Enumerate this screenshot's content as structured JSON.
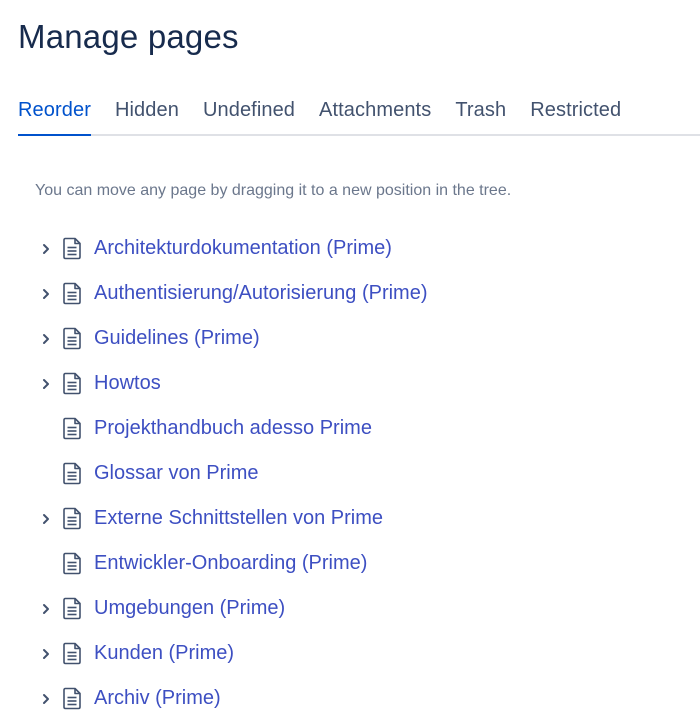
{
  "title": "Manage pages",
  "tabs": [
    {
      "label": "Reorder",
      "active": true
    },
    {
      "label": "Hidden",
      "active": false
    },
    {
      "label": "Undefined",
      "active": false
    },
    {
      "label": "Attachments",
      "active": false
    },
    {
      "label": "Trash",
      "active": false
    },
    {
      "label": "Restricted",
      "active": false
    }
  ],
  "help_text": "You can move any page by dragging it to a new position in the tree.",
  "tree": [
    {
      "label": "Architekturdokumentation (Prime)",
      "has_children": true
    },
    {
      "label": "Authentisierung/Autorisierung (Prime)",
      "has_children": true
    },
    {
      "label": "Guidelines (Prime)",
      "has_children": true
    },
    {
      "label": "Howtos",
      "has_children": true
    },
    {
      "label": "Projekthandbuch adesso Prime",
      "has_children": false
    },
    {
      "label": "Glossar von Prime",
      "has_children": false
    },
    {
      "label": "Externe Schnittstellen von Prime",
      "has_children": true
    },
    {
      "label": "Entwickler-Onboarding (Prime)",
      "has_children": false
    },
    {
      "label": "Umgebungen (Prime)",
      "has_children": true
    },
    {
      "label": "Kunden (Prime)",
      "has_children": true
    },
    {
      "label": "Archiv (Prime)",
      "has_children": true
    }
  ],
  "icons": {
    "expand": "chevron-right-icon",
    "page": "page-icon"
  },
  "colors": {
    "title": "#172b4d",
    "tab_active": "#0052cc",
    "tab_inactive": "#42526e",
    "link": "#3d4fc2",
    "help_text": "#6b778c"
  }
}
